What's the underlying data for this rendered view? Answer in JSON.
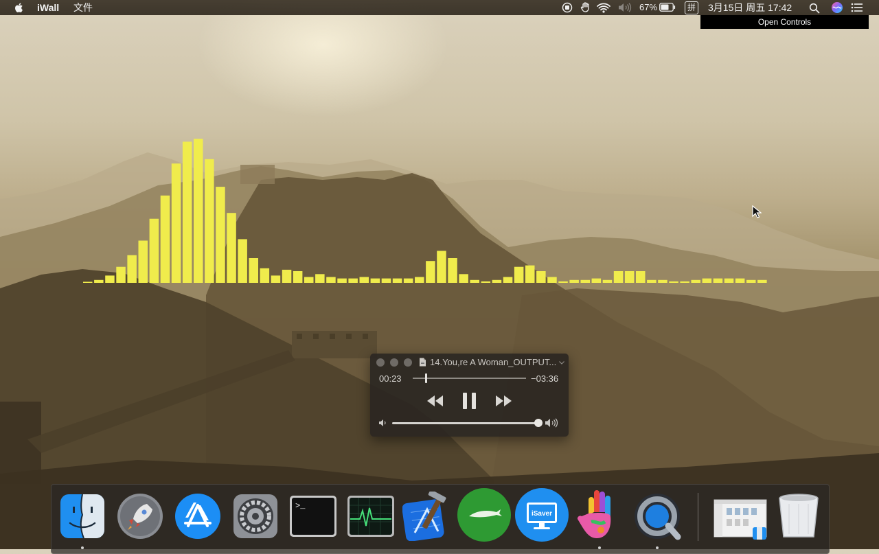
{
  "menubar": {
    "app_name": "iWall",
    "file_menu": "文件",
    "battery_percent": "67%",
    "input_method": "拼",
    "datetime": "3月15日 周五  17:42"
  },
  "tooltip": {
    "text": "Open Controls"
  },
  "visualizer": {
    "color": "#f0ec4c",
    "levels": [
      0.5,
      2,
      5,
      11,
      19,
      29,
      44,
      60,
      82,
      97,
      99,
      85,
      66,
      48,
      30,
      17,
      10,
      5,
      9,
      8,
      4,
      6,
      4,
      3,
      3,
      4,
      3,
      3,
      3,
      3,
      4,
      15,
      22,
      17,
      6,
      2,
      1,
      2,
      4,
      11,
      12,
      8,
      4,
      1,
      2,
      2,
      3,
      2,
      8,
      8,
      8,
      2,
      2,
      1,
      1,
      2,
      3,
      3,
      3,
      3,
      2,
      2
    ]
  },
  "player": {
    "title": "14.You,re A Woman_OUTPUT...",
    "elapsed": "00:23",
    "remaining": "−03:36",
    "progress": 0.11,
    "volume": 1.0
  },
  "dock": {
    "items": [
      {
        "name": "finder",
        "running": true
      },
      {
        "name": "launchpad",
        "running": false
      },
      {
        "name": "app-store",
        "running": false
      },
      {
        "name": "system-preferences",
        "running": false
      },
      {
        "name": "terminal",
        "running": false
      },
      {
        "name": "activity-monitor",
        "running": false
      },
      {
        "name": "xcode",
        "running": false
      },
      {
        "name": "aquarium-app",
        "running": false
      },
      {
        "name": "isaver",
        "running": false
      },
      {
        "name": "hand-app",
        "running": true
      },
      {
        "name": "quicktime-player",
        "running": true
      },
      {
        "name": "finder-window",
        "running": false
      },
      {
        "name": "trash",
        "running": false
      }
    ],
    "isaver_label": "iSaver"
  }
}
